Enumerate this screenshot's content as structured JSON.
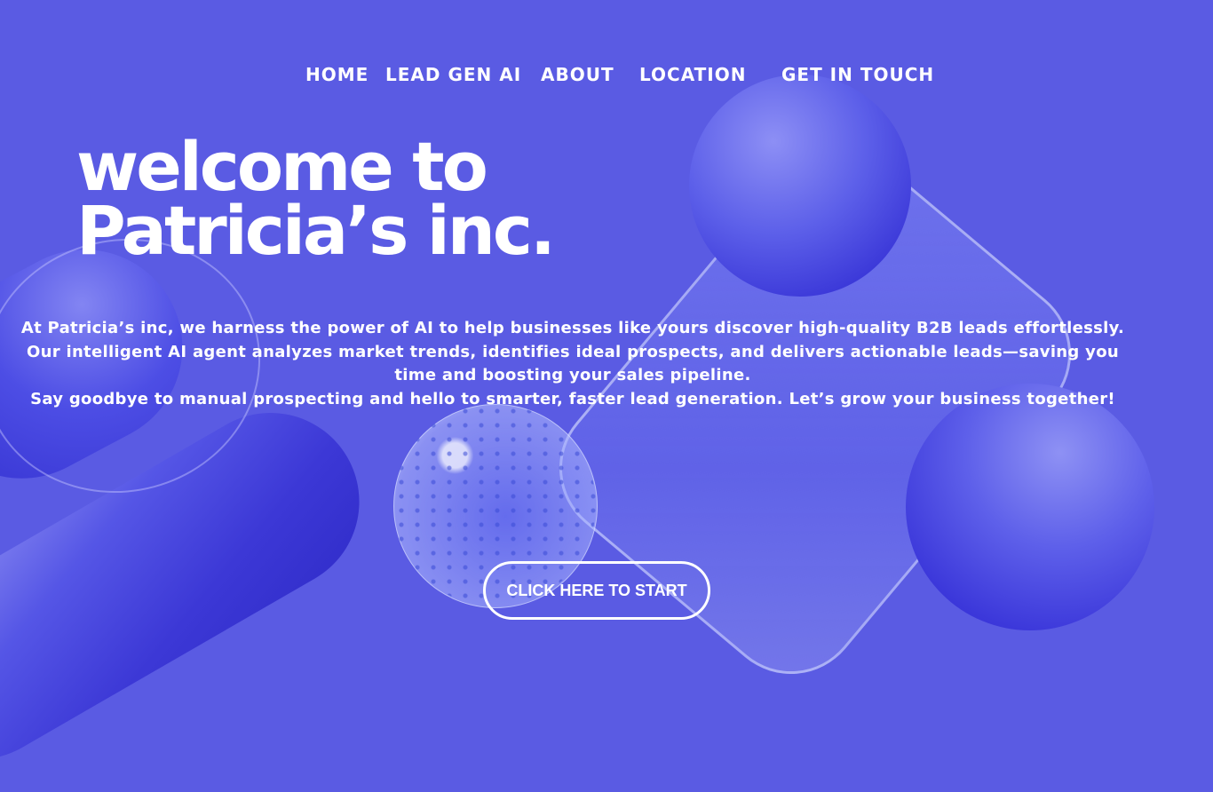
{
  "nav": {
    "items": [
      {
        "label": "HOME"
      },
      {
        "label": "LEAD GEN AI"
      },
      {
        "label": "ABOUT"
      },
      {
        "label": "LOCATION"
      },
      {
        "label": "GET IN TOUCH"
      }
    ]
  },
  "hero": {
    "title_line1": "welcome to",
    "title_line2": "Patricia’s inc.",
    "paragraph1": "At Patricia’s inc, we harness the power of AI to help businesses like yours discover high-quality B2B leads effortlessly. Our intelligent AI agent analyzes market trends, identifies ideal prospects, and delivers actionable leads—saving you time and boosting your sales pipeline.",
    "paragraph2": "Say goodbye to manual prospecting and hello to smarter, faster lead generation. Let’s grow your business together!",
    "cta_label": "CLICK HERE TO START"
  },
  "colors": {
    "background": "#5a5be3",
    "text": "#ffffff",
    "sphere": "#3b37da"
  }
}
